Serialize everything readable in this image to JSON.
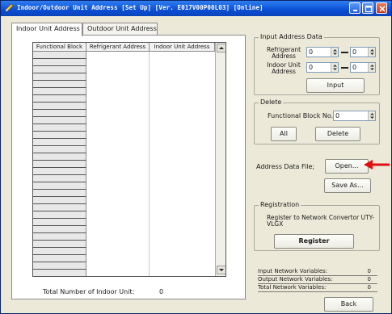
{
  "window": {
    "title": "Indoor/Outdoor Unit Address  [Set Up] [Ver. E017V00P00L03] [Online]"
  },
  "tabs": [
    {
      "label": "Indoor Unit Address",
      "active": true
    },
    {
      "label": "Outdoor Unit Address",
      "active": false
    }
  ],
  "table": {
    "columns": [
      "Functional Block",
      "Refrigerant Address",
      "Indoor Unit Address"
    ],
    "row_count": 31
  },
  "total": {
    "label": "Total Number of Indoor Unit:",
    "value": "0"
  },
  "input_address": {
    "group_label": "Input Address Data",
    "refrigerant_label": "Refrigerant Address",
    "refrigerant_from": "0",
    "refrigerant_to": "0",
    "indoor_label": "Indoor Unit Address",
    "indoor_from": "0",
    "indoor_to": "0",
    "input_button": "Input"
  },
  "delete": {
    "group_label": "Delete",
    "fb_label": "Functional Block No.",
    "fb_value": "0",
    "all_button": "All",
    "delete_button": "Delete"
  },
  "address_file": {
    "label": "Address Data File;",
    "open_button": "Open...",
    "saveas_button": "Save As..."
  },
  "registration": {
    "group_label": "Registration",
    "description": "Register to Network Convertor UTY-VLGX",
    "register_button": "Register"
  },
  "network_vars": [
    {
      "label": "Input Network Variables:",
      "value": "0"
    },
    {
      "label": "Output Network Variables:",
      "value": "0"
    },
    {
      "label": "Total Network Variables:",
      "value": "0"
    }
  ],
  "back_button": "Back",
  "colors": {
    "titlebar": "#0a4fd6",
    "window_bg": "#ece9d8",
    "pointer_arrow": "#e01010"
  },
  "icons": {
    "app": "pencil-icon",
    "minimize": "minimize-icon",
    "maximize": "maximize-icon",
    "close": "close-icon",
    "pointer": "red-arrow-icon"
  }
}
